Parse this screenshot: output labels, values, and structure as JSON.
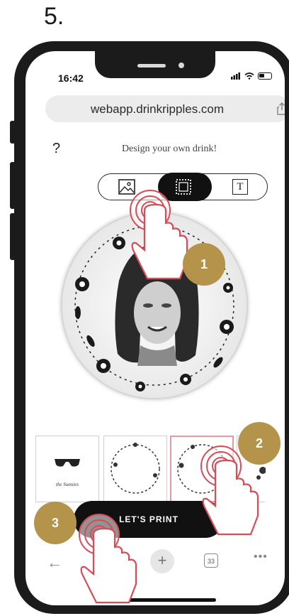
{
  "step_number": "5.",
  "status": {
    "time": "16:42"
  },
  "browser": {
    "url": "webapp.drinkripples.com",
    "tab_count": "33"
  },
  "header": {
    "help_label": "?",
    "title": "Design your own drink!",
    "close_label": "✕"
  },
  "mode_switch": {
    "items": [
      {
        "icon": "image-icon",
        "active": false
      },
      {
        "icon": "frame-icon",
        "active": true
      },
      {
        "icon": "text-icon",
        "active": false
      }
    ],
    "text_label": "T"
  },
  "thumbnails": [
    {
      "caption": "the Sunnies",
      "selected": false
    },
    {
      "caption": "",
      "selected": false
    },
    {
      "caption": "",
      "selected": true
    }
  ],
  "print_button_label": "LET'S PRINT",
  "steps": [
    "1",
    "2",
    "3"
  ],
  "colors": {
    "accent_badge": "#b4944a",
    "selected_border": "#e39aa0",
    "tap_indicator": "#d94b57"
  }
}
